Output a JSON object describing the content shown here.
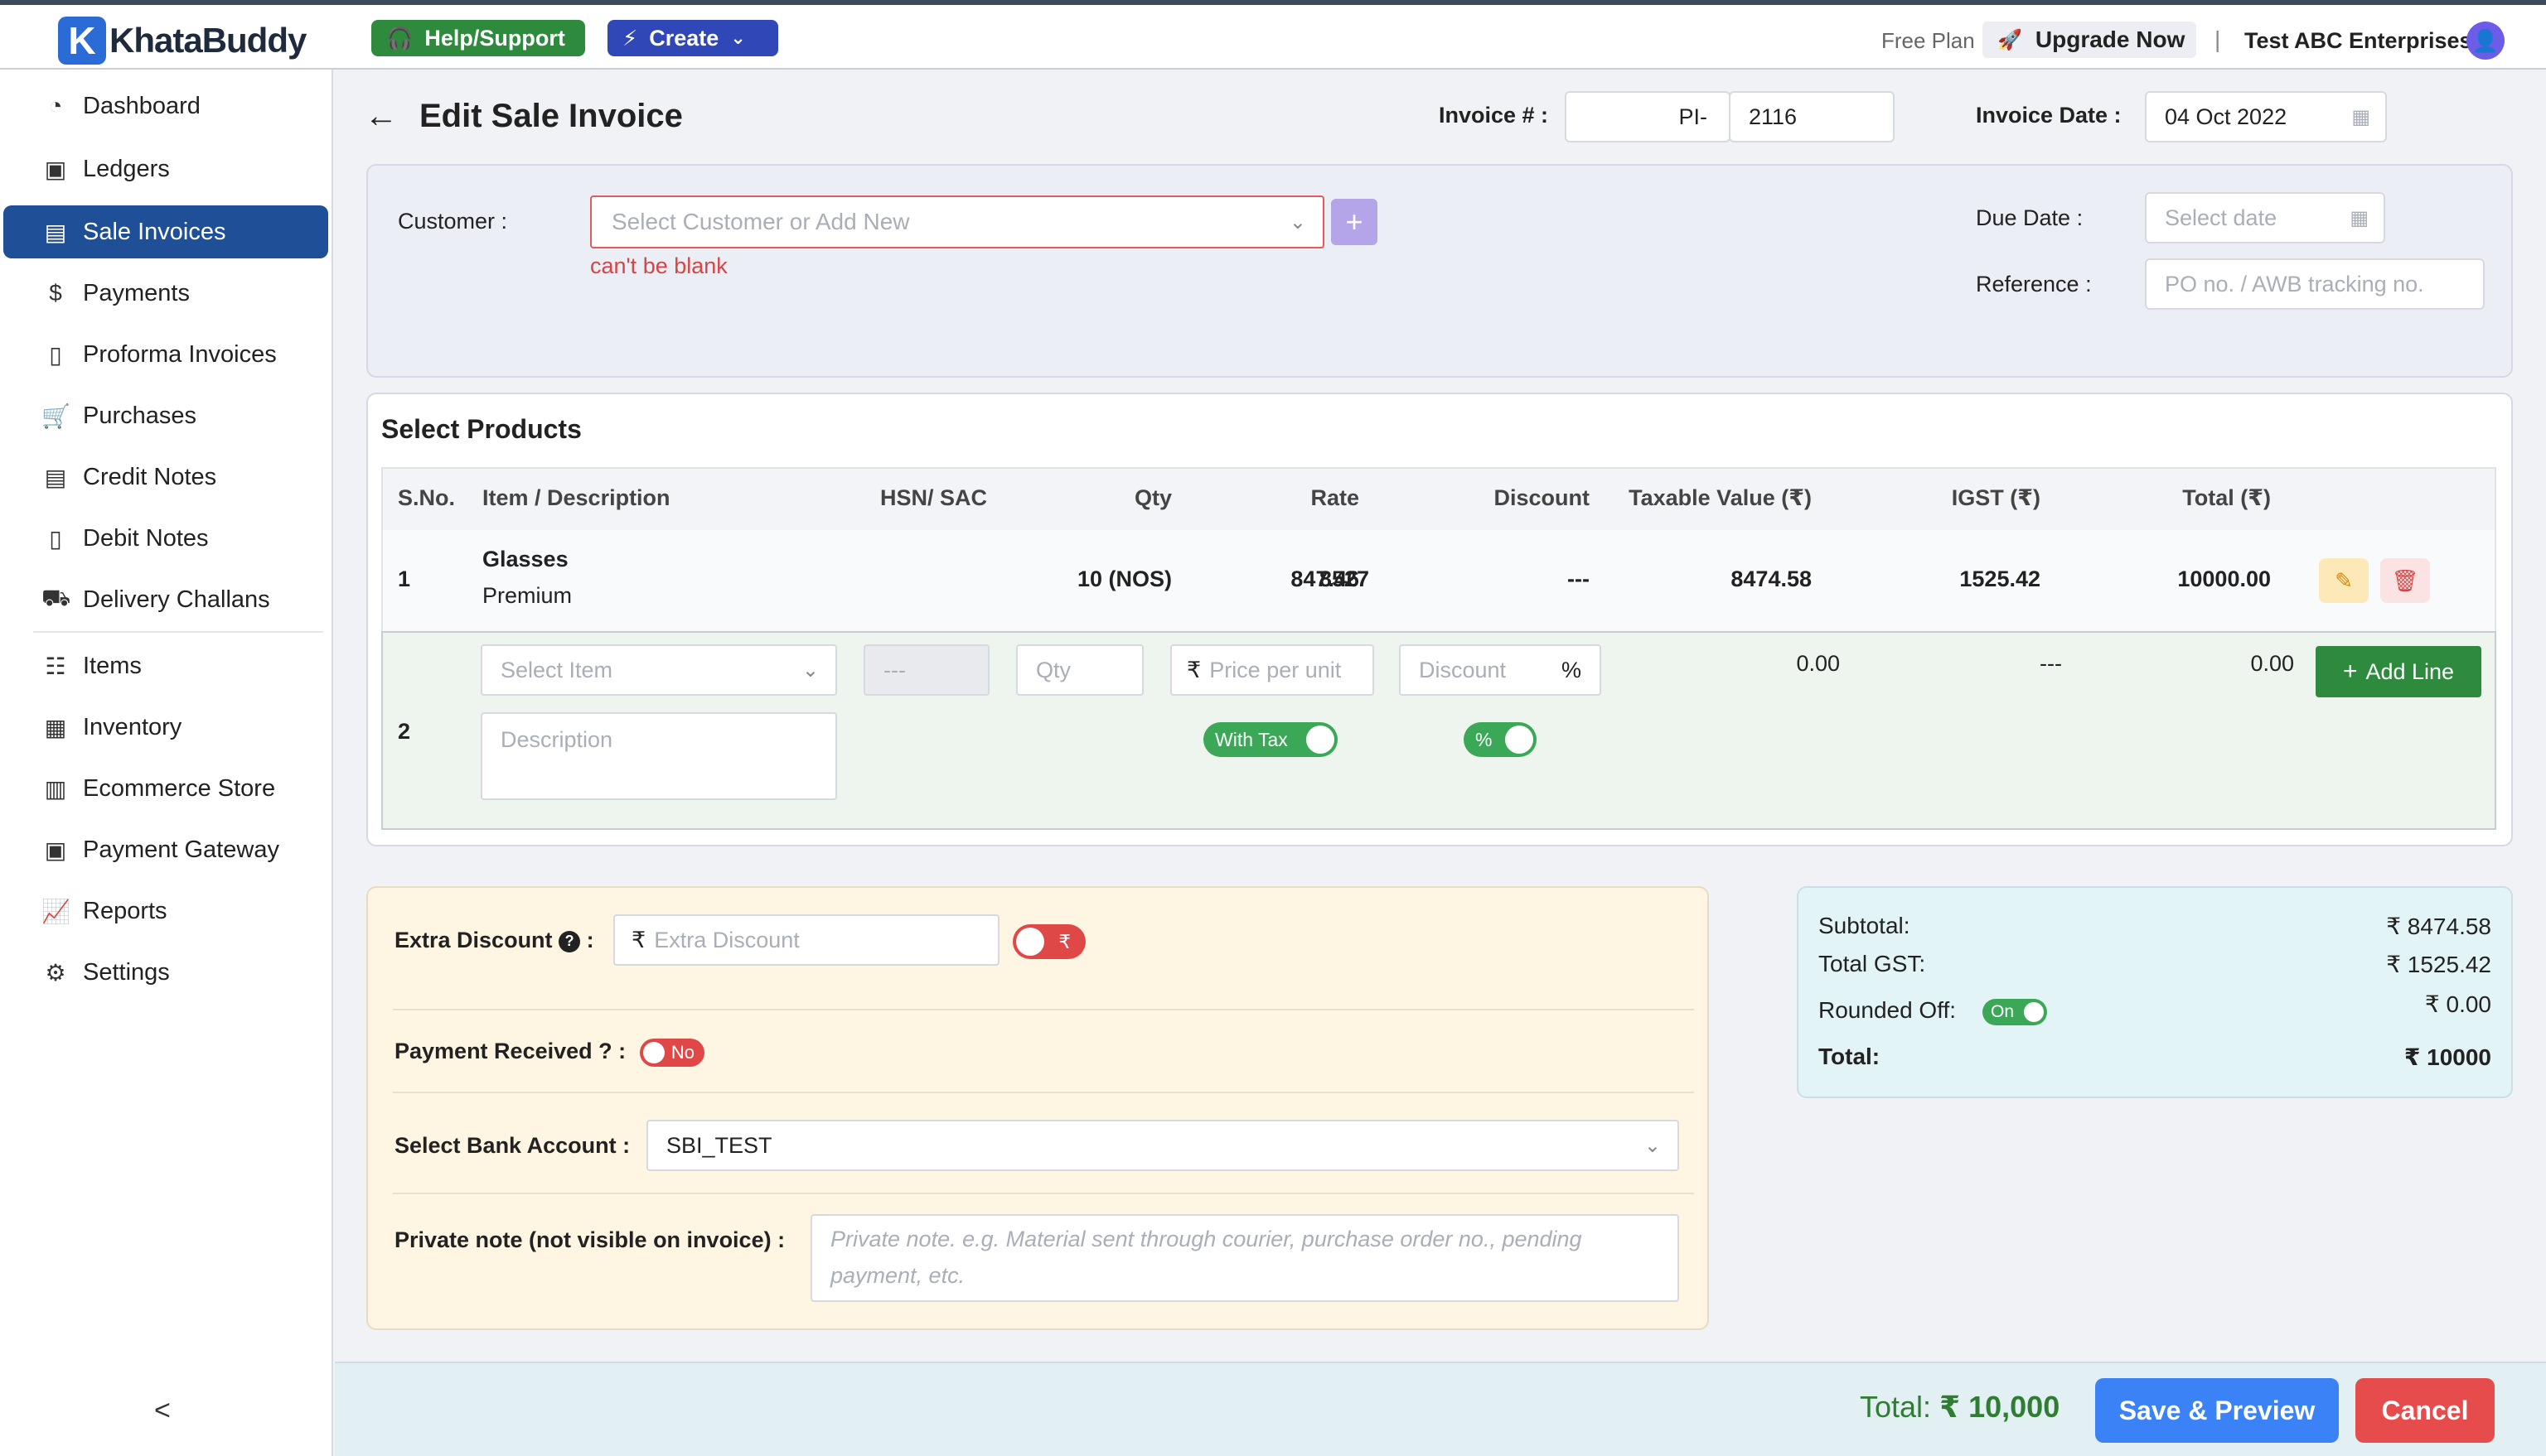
{
  "brand": {
    "logo_letter": "K",
    "name": "KhataBuddy"
  },
  "topbar": {
    "help_label": "Help/Support",
    "create_label": "Create",
    "plan": "Free Plan",
    "upgrade_label": "Upgrade Now",
    "separator": "|",
    "company": "Test ABC Enterprises"
  },
  "sidebar": {
    "items": [
      {
        "label": "Dashboard",
        "icon": "dashboard-icon"
      },
      {
        "label": "Ledgers",
        "icon": "ledger-icon"
      },
      {
        "label": "Sale Invoices",
        "icon": "invoice-icon",
        "active": true
      },
      {
        "label": "Payments",
        "icon": "payment-icon"
      },
      {
        "label": "Proforma Invoices",
        "icon": "document-icon"
      },
      {
        "label": "Purchases",
        "icon": "cart-icon"
      },
      {
        "label": "Credit Notes",
        "icon": "note-icon"
      },
      {
        "label": "Debit Notes",
        "icon": "file-icon"
      },
      {
        "label": "Delivery Challans",
        "icon": "truck-icon"
      },
      {
        "label": "Items",
        "icon": "items-icon"
      },
      {
        "label": "Inventory",
        "icon": "inventory-icon"
      },
      {
        "label": "Ecommerce Store",
        "icon": "store-icon"
      },
      {
        "label": "Payment Gateway",
        "icon": "gateway-icon"
      },
      {
        "label": "Reports",
        "icon": "chart-icon"
      },
      {
        "label": "Settings",
        "icon": "gear-icon"
      }
    ],
    "collapse_glyph": "<"
  },
  "header": {
    "title": "Edit Sale Invoice",
    "invoice_label": "Invoice # :",
    "invoice_prefix": "PI-",
    "invoice_number": "2116",
    "invoice_date_label": "Invoice Date :",
    "invoice_date": "04 Oct 2022"
  },
  "customer": {
    "label": "Customer :",
    "placeholder": "Select Customer or Add New",
    "error": "can't be blank",
    "due_date_label": "Due Date :",
    "due_date_placeholder": "Select date",
    "reference_label": "Reference :",
    "reference_placeholder": "PO no. / AWB tracking no."
  },
  "products": {
    "title": "Select Products",
    "columns": [
      "S.No.",
      "Item / Description",
      "HSN/ SAC",
      "Qty",
      "Rate",
      "Discount",
      "Taxable Value (₹)",
      "IGST (₹)",
      "Total (₹)"
    ],
    "rows": [
      {
        "sno": "1",
        "item": "Glasses",
        "desc": "Premium",
        "hsn": "8527",
        "qty": "10 (NOS)",
        "rate": "847.46",
        "discount": "---",
        "taxable": "8474.58",
        "igst": "1525.42",
        "total": "10000.00"
      }
    ],
    "new_line": {
      "sno": "2",
      "item_placeholder": "Select Item",
      "hsn_placeholder": "---",
      "qty_placeholder": "Qty",
      "rate_placeholder": "Price per unit",
      "discount_placeholder": "Discount",
      "discount_unit": "%",
      "desc_placeholder": "Description",
      "with_tax_label": "With Tax",
      "pct_toggle_label": "%",
      "taxable": "0.00",
      "igst": "---",
      "total": "0.00",
      "add_line_label": "Add Line"
    }
  },
  "extras": {
    "extra_discount_label": "Extra Discount",
    "extra_discount_placeholder": "Extra Discount",
    "rupee_toggle": "₹",
    "payment_received_label": "Payment Received ? :",
    "payment_toggle": "No",
    "bank_label": "Select Bank Account :",
    "bank_value": "SBI_TEST",
    "note_label": "Private note (not visible on invoice) :",
    "note_placeholder": "Private note. e.g. Material sent through courier, purchase order no., pending payment, etc."
  },
  "summary": {
    "subtotal_label": "Subtotal:",
    "subtotal": "₹ 8474.58",
    "gst_label": "Total GST:",
    "gst": "₹ 1525.42",
    "round_label": "Rounded Off:",
    "round_toggle": "On",
    "round_value": "₹ 0.00",
    "total_label": "Total:",
    "total": "₹ 10000"
  },
  "footer": {
    "total_label": "Total:",
    "total_value": "₹ 10,000",
    "save_label": "Save & Preview",
    "cancel_label": "Cancel"
  },
  "colors": {
    "accent": "#1f4f96",
    "success": "#2e8b3e",
    "danger": "#e74c4c",
    "primary": "#3b82f6"
  }
}
